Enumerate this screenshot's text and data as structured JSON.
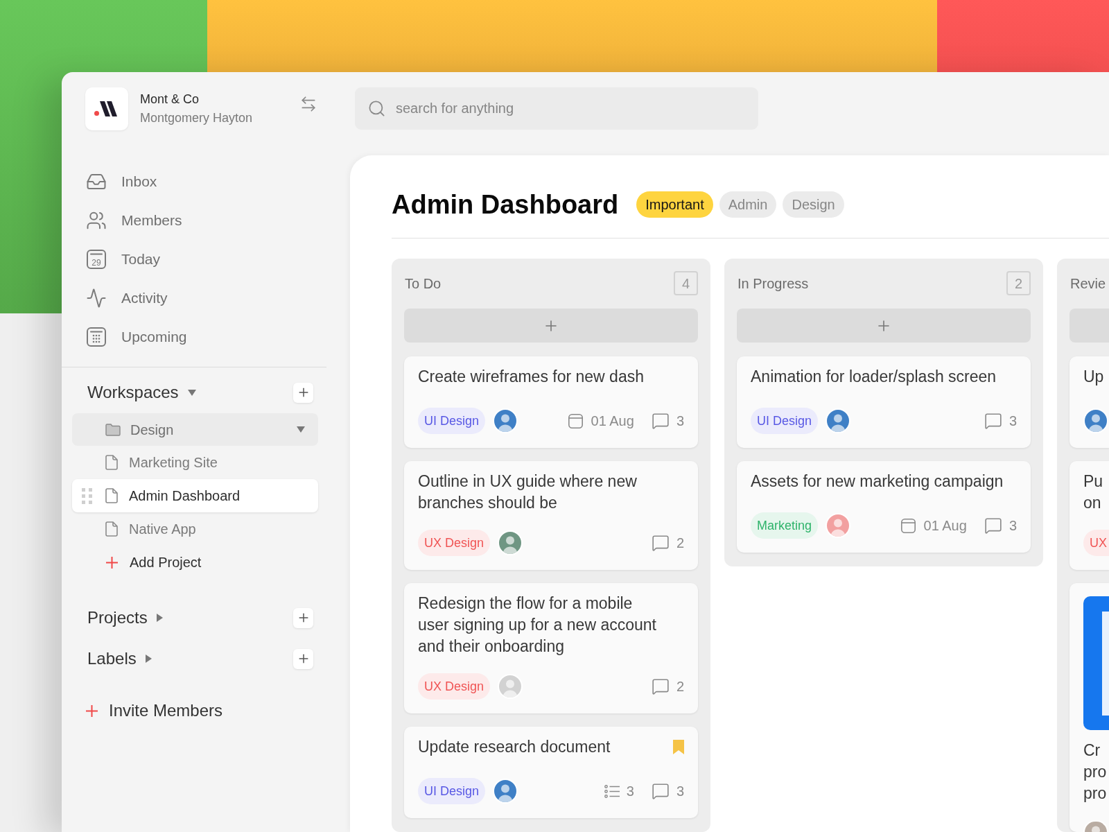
{
  "workspace": {
    "name": "Mont & Co",
    "user": "Montgomery Hayton"
  },
  "nav": [
    {
      "label": "Inbox"
    },
    {
      "label": "Members"
    },
    {
      "label": "Today",
      "icon_text": "29"
    },
    {
      "label": "Activity"
    },
    {
      "label": "Upcoming"
    }
  ],
  "sections": [
    {
      "title": "Workspaces",
      "expanded": true,
      "folders": [
        {
          "name": "Design",
          "expanded": true,
          "children": [
            {
              "name": "Marketing Site",
              "selected": false
            },
            {
              "name": "Admin Dashboard",
              "selected": true
            },
            {
              "name": "Native App",
              "selected": false
            }
          ],
          "add_label": "Add Project"
        }
      ]
    },
    {
      "title": "Projects",
      "expanded": false
    },
    {
      "title": "Labels",
      "expanded": false
    }
  ],
  "invite": {
    "label": "Invite Members"
  },
  "search": {
    "placeholder": "search for anything"
  },
  "page": {
    "title": "Admin Dashboard",
    "tags": [
      {
        "label": "Important",
        "kind": "priority"
      },
      {
        "label": "Admin",
        "kind": "plain"
      },
      {
        "label": "Design",
        "kind": "plain"
      }
    ]
  },
  "board": {
    "columns": [
      {
        "title": "To Do",
        "count": "4",
        "cards": [
          {
            "title": "Create wireframes for new dash",
            "tag": {
              "label": "UI Design",
              "color": "#5858e4"
            },
            "avatar": {
              "color": "#3f80c6"
            },
            "due": "01 Aug",
            "comments": "3",
            "bookmarked": false
          },
          {
            "title": "Outline in UX guide where new\nbranches should be",
            "tag": {
              "label": "UX Design",
              "color": "#f05454"
            },
            "avatar": {
              "color": "#6f9683"
            },
            "comments": "2",
            "bookmarked": false
          },
          {
            "title": "Redesign the flow for a mobile\nuser signing up for a new account\nand their onboarding",
            "tag": {
              "label": "UX Design",
              "color": "#f05454"
            },
            "avatar": {
              "color": "#d2d2d2"
            },
            "comments": "2",
            "bookmarked": false
          },
          {
            "title": "Update research document",
            "tag": {
              "label": "UI Design",
              "color": "#5858e4"
            },
            "avatar": {
              "color": "#3f80c6"
            },
            "checklist": "3",
            "comments": "3",
            "bookmarked": true
          }
        ]
      },
      {
        "title": "In Progress",
        "count": "2",
        "cards": [
          {
            "title": "Animation for loader/splash screen",
            "tag": {
              "label": "UI Design",
              "color": "#5858e4"
            },
            "avatar": {
              "color": "#3f80c6"
            },
            "comments": "3",
            "bookmarked": false
          },
          {
            "title": "Assets for new marketing campaign",
            "tag": {
              "label": "Marketing",
              "color": "#2eb36a"
            },
            "avatar": {
              "color": "#f2a0a0"
            },
            "due": "01 Aug",
            "comments": "3",
            "bookmarked": false
          }
        ]
      },
      {
        "title": "Revie",
        "cards": [
          {
            "title": "Up",
            "avatar": {
              "color": "#3f80c6"
            }
          },
          {
            "title": "Pu\non",
            "tag": {
              "label": "UX",
              "color": "#f05454"
            }
          },
          {
            "title": "Cr\npro\npro",
            "image": true,
            "avatar": {
              "color": "#b9aca2"
            }
          }
        ]
      }
    ]
  }
}
